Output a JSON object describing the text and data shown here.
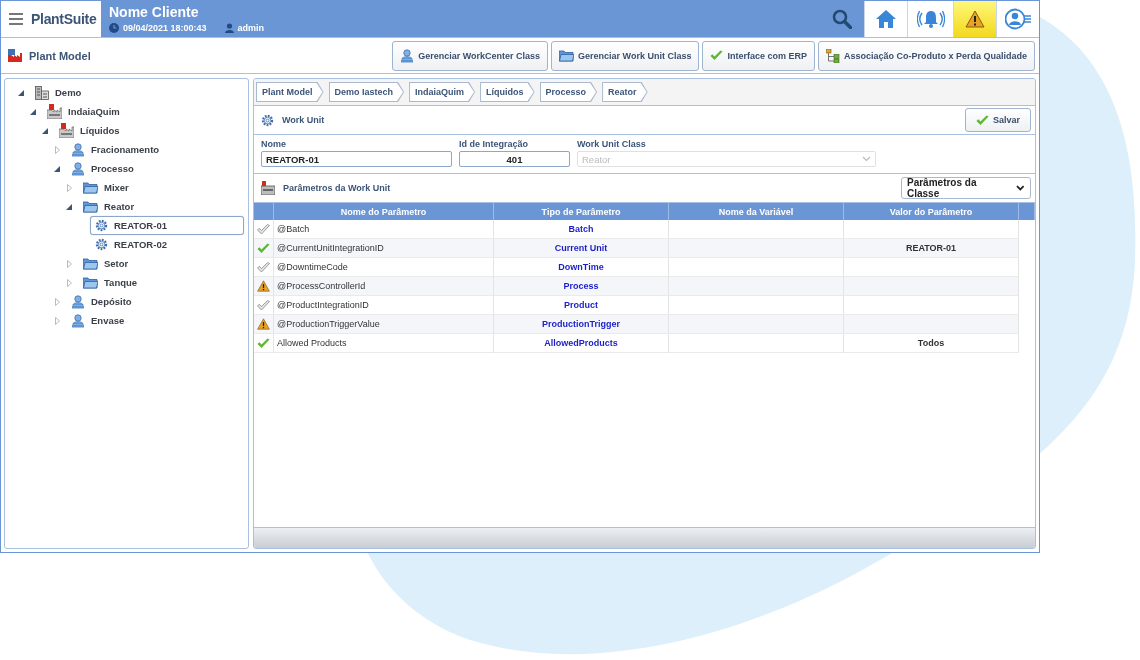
{
  "header": {
    "brand": "PlantSuite",
    "client": "Nome Cliente",
    "datetime": "09/04/2021 18:00:43",
    "user": "admin",
    "nav_buttons": [
      {
        "kind": "home",
        "selected": false
      },
      {
        "kind": "alarms",
        "selected": false
      },
      {
        "kind": "warnings",
        "selected": true
      },
      {
        "kind": "account",
        "selected": false
      }
    ]
  },
  "toolbar": {
    "title": "Plant Model",
    "buttons": [
      {
        "label": "Gerenciar WorkCenter Class",
        "kind": "workcenter"
      },
      {
        "label": "Gerenciar Work Unit Class",
        "kind": "folder"
      },
      {
        "label": "Interface com ERP",
        "kind": "check"
      },
      {
        "label": "Associação Co-Produto x Perda Qualidade",
        "kind": "hierarchy"
      }
    ]
  },
  "tree": [
    {
      "label": "Demo",
      "kind": "enterprise",
      "expanded": true,
      "selected": false,
      "children": [
        {
          "label": "IndaiaQuim",
          "kind": "site",
          "expanded": true,
          "selected": false,
          "children": [
            {
              "label": "Líquidos",
              "kind": "site",
              "expanded": true,
              "selected": false,
              "children": [
                {
                  "label": "Fracionamento",
                  "kind": "workcenter",
                  "expanded": false,
                  "selected": false
                },
                {
                  "label": "Processo",
                  "kind": "workcenter",
                  "expanded": true,
                  "selected": false,
                  "children": [
                    {
                      "label": "Mixer",
                      "kind": "folder",
                      "expanded": false,
                      "selected": false
                    },
                    {
                      "label": "Reator",
                      "kind": "folder",
                      "expanded": true,
                      "selected": false,
                      "children": [
                        {
                          "label": "REATOR-01",
                          "kind": "unit",
                          "selected": true
                        },
                        {
                          "label": "REATOR-02",
                          "kind": "unit",
                          "selected": false
                        }
                      ]
                    },
                    {
                      "label": "Setor",
                      "kind": "folder",
                      "expanded": false,
                      "selected": false
                    },
                    {
                      "label": "Tanque",
                      "kind": "folder",
                      "expanded": false,
                      "selected": false
                    }
                  ]
                },
                {
                  "label": "Depósito",
                  "kind": "workcenter",
                  "expanded": false,
                  "selected": false
                },
                {
                  "label": "Envase",
                  "kind": "workcenter",
                  "expanded": false,
                  "selected": false
                }
              ]
            }
          ]
        }
      ]
    }
  ],
  "breadcrumb": [
    "Plant Model",
    "Demo Iastech",
    "IndaiaQuim",
    "Líquidos",
    "Processo",
    "Reator"
  ],
  "work_unit": {
    "title": "Work Unit",
    "save_label": "Salvar",
    "fields": [
      {
        "label": "Nome",
        "value": "REATOR-01",
        "kind": "text",
        "disabled": false
      },
      {
        "label": "Id de Integração",
        "value": "401",
        "kind": "number",
        "disabled": false
      },
      {
        "label": "Work Unit Class",
        "value": "Reator",
        "kind": "select",
        "disabled": true
      }
    ]
  },
  "parameters": {
    "title": "Parâmetros da Work Unit",
    "filter": "Parâmetros da Classe",
    "columns": [
      "Nome do Parâmetro",
      "Tipo de Parâmetro",
      "Nome da Variável",
      "Valor do Parâmetro"
    ],
    "rows": [
      {
        "kind": "unset",
        "name": "@Batch",
        "type": "Batch"
      },
      {
        "kind": "ok",
        "name": "@CurrentUnitIntegrationID",
        "type": "Current Unit",
        "value": "REATOR-01"
      },
      {
        "kind": "unset",
        "name": "@DowntimeCode",
        "type": "DownTime"
      },
      {
        "kind": "warning",
        "name": "@ProcessControllerId",
        "type": "Process"
      },
      {
        "kind": "unset",
        "name": "@ProductIntegrationID",
        "type": "Product"
      },
      {
        "kind": "warning",
        "name": "@ProductionTriggerValue",
        "type": "ProductionTrigger"
      },
      {
        "kind": "ok",
        "name": "Allowed Products",
        "type": "AllowedProducts",
        "value": "Todos"
      }
    ]
  }
}
